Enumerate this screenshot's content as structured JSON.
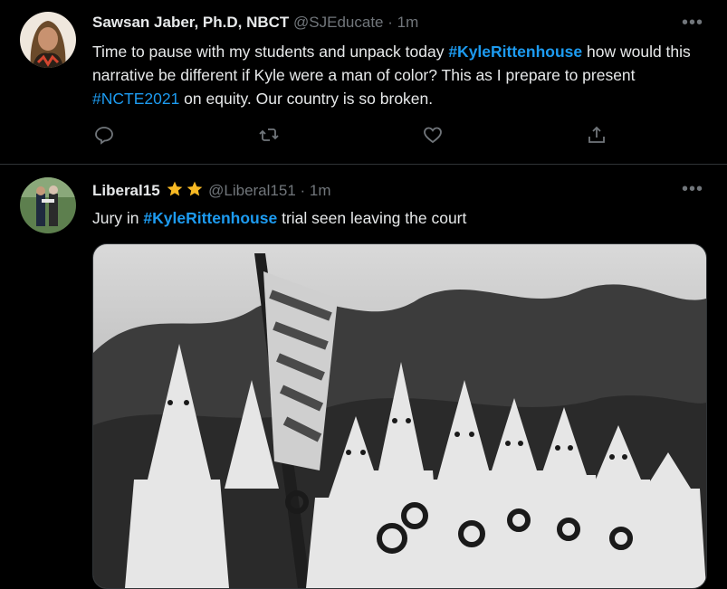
{
  "tweet1": {
    "name": "Sawsan Jaber, Ph.D, NBCT",
    "handle": "@SJEducate",
    "dot": "·",
    "time": "1m",
    "text_a": "Time to pause with my students and unpack today ",
    "hashtag1": "#KyleRittenhouse",
    "text_b": " how would this narrative be different if Kyle were a man of color? This as I prepare to present ",
    "hashtag2": "#NCTE2021",
    "text_c": " on equity. Our country is so broken."
  },
  "tweet2": {
    "name": "Liberal15",
    "handle": "@Liberal151",
    "dot": "·",
    "time": "1m",
    "text_a": "Jury in ",
    "hashtag1": "#KyleRittenhouse",
    "text_b": " trial seen leaving the court"
  },
  "more_label": "•••",
  "colors": {
    "accent": "#1d9bf0",
    "muted": "#71767b",
    "star": "#f7b924"
  },
  "icons": [
    "reply-icon",
    "retweet-icon",
    "like-icon",
    "share-icon",
    "more-icon",
    "star-icon"
  ]
}
